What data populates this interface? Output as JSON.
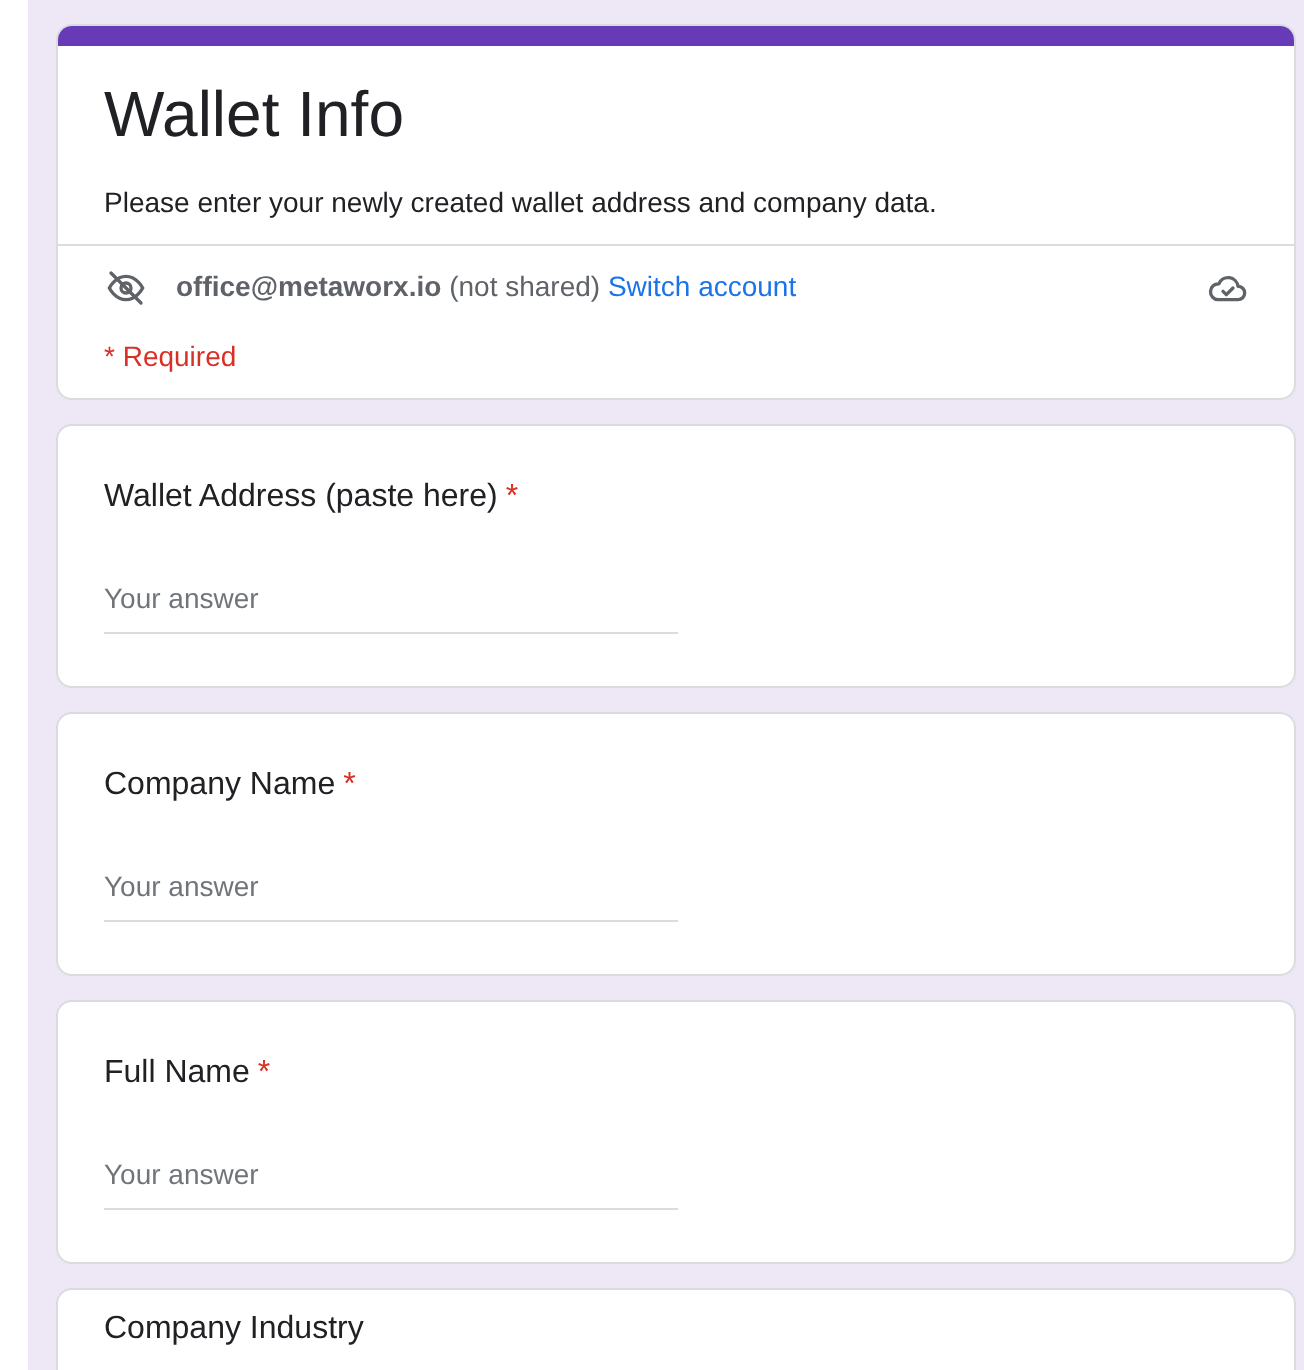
{
  "header": {
    "title": "Wallet Info",
    "description": "Please enter your newly created wallet address and company data.",
    "account": {
      "email": "office@metaworx.io",
      "note": "(not shared)",
      "switch_link": "Switch account"
    },
    "required_note": "* Required"
  },
  "questions": [
    {
      "label": "Wallet Address (paste here)",
      "required": true,
      "required_mark": "*",
      "placeholder": "Your answer"
    },
    {
      "label": "Company Name",
      "required": true,
      "required_mark": "*",
      "placeholder": "Your answer"
    },
    {
      "label": "Full Name",
      "required": true,
      "required_mark": "*",
      "placeholder": "Your answer"
    },
    {
      "label": "Company Industry"
    }
  ]
}
